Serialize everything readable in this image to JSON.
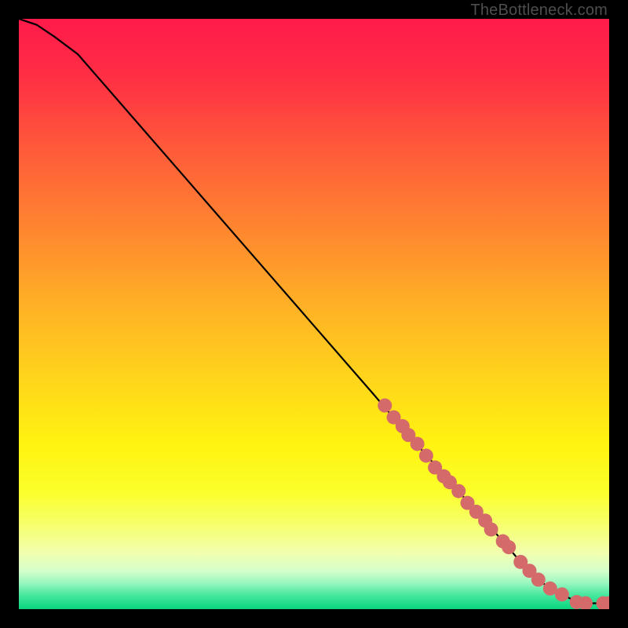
{
  "watermark": "TheBottleneck.com",
  "chart_data": {
    "type": "line",
    "title": "",
    "xlabel": "",
    "ylabel": "",
    "xlim": [
      0,
      100
    ],
    "ylim": [
      0,
      100
    ],
    "curve": {
      "name": "bottleneck-curve",
      "x": [
        0,
        3,
        6,
        10,
        20,
        30,
        40,
        50,
        60,
        66,
        70,
        74,
        78,
        82,
        85,
        88,
        90,
        92,
        94,
        96,
        98,
        100
      ],
      "y": [
        100,
        99,
        97,
        94,
        82.5,
        71,
        59.5,
        48,
        36.5,
        29.5,
        25,
        20.5,
        16,
        11.5,
        8,
        5,
        3.5,
        2.5,
        1.5,
        1,
        1,
        1
      ]
    },
    "points": {
      "name": "data-points",
      "color": "#d46a6a",
      "coords": [
        [
          62,
          34.5
        ],
        [
          63.5,
          32.5
        ],
        [
          65,
          31
        ],
        [
          66,
          29.5
        ],
        [
          67.5,
          28
        ],
        [
          69,
          26
        ],
        [
          70.5,
          24
        ],
        [
          72,
          22.5
        ],
        [
          73,
          21.5
        ],
        [
          74.5,
          20
        ],
        [
          76,
          18
        ],
        [
          77.5,
          16.5
        ],
        [
          79,
          15
        ],
        [
          80,
          13.5
        ],
        [
          82,
          11.5
        ],
        [
          83,
          10.5
        ],
        [
          85,
          8
        ],
        [
          86.5,
          6.5
        ],
        [
          88,
          5
        ],
        [
          90,
          3.5
        ],
        [
          92,
          2.5
        ],
        [
          94.5,
          1.2
        ],
        [
          96,
          1
        ],
        [
          99,
          1
        ],
        [
          100,
          1
        ]
      ]
    },
    "gradient_stops": [
      {
        "offset": 0.0,
        "color": "#ff1a4b"
      },
      {
        "offset": 0.1,
        "color": "#ff2f44"
      },
      {
        "offset": 0.22,
        "color": "#ff5a3a"
      },
      {
        "offset": 0.35,
        "color": "#ff8430"
      },
      {
        "offset": 0.48,
        "color": "#ffaf26"
      },
      {
        "offset": 0.6,
        "color": "#ffd21c"
      },
      {
        "offset": 0.72,
        "color": "#fff310"
      },
      {
        "offset": 0.8,
        "color": "#fbff2a"
      },
      {
        "offset": 0.86,
        "color": "#f6ff70"
      },
      {
        "offset": 0.905,
        "color": "#f2ffb0"
      },
      {
        "offset": 0.935,
        "color": "#d4ffca"
      },
      {
        "offset": 0.955,
        "color": "#9cf7c0"
      },
      {
        "offset": 0.975,
        "color": "#4be8a0"
      },
      {
        "offset": 0.995,
        "color": "#14d985"
      },
      {
        "offset": 1.0,
        "color": "#0fd07f"
      }
    ]
  }
}
